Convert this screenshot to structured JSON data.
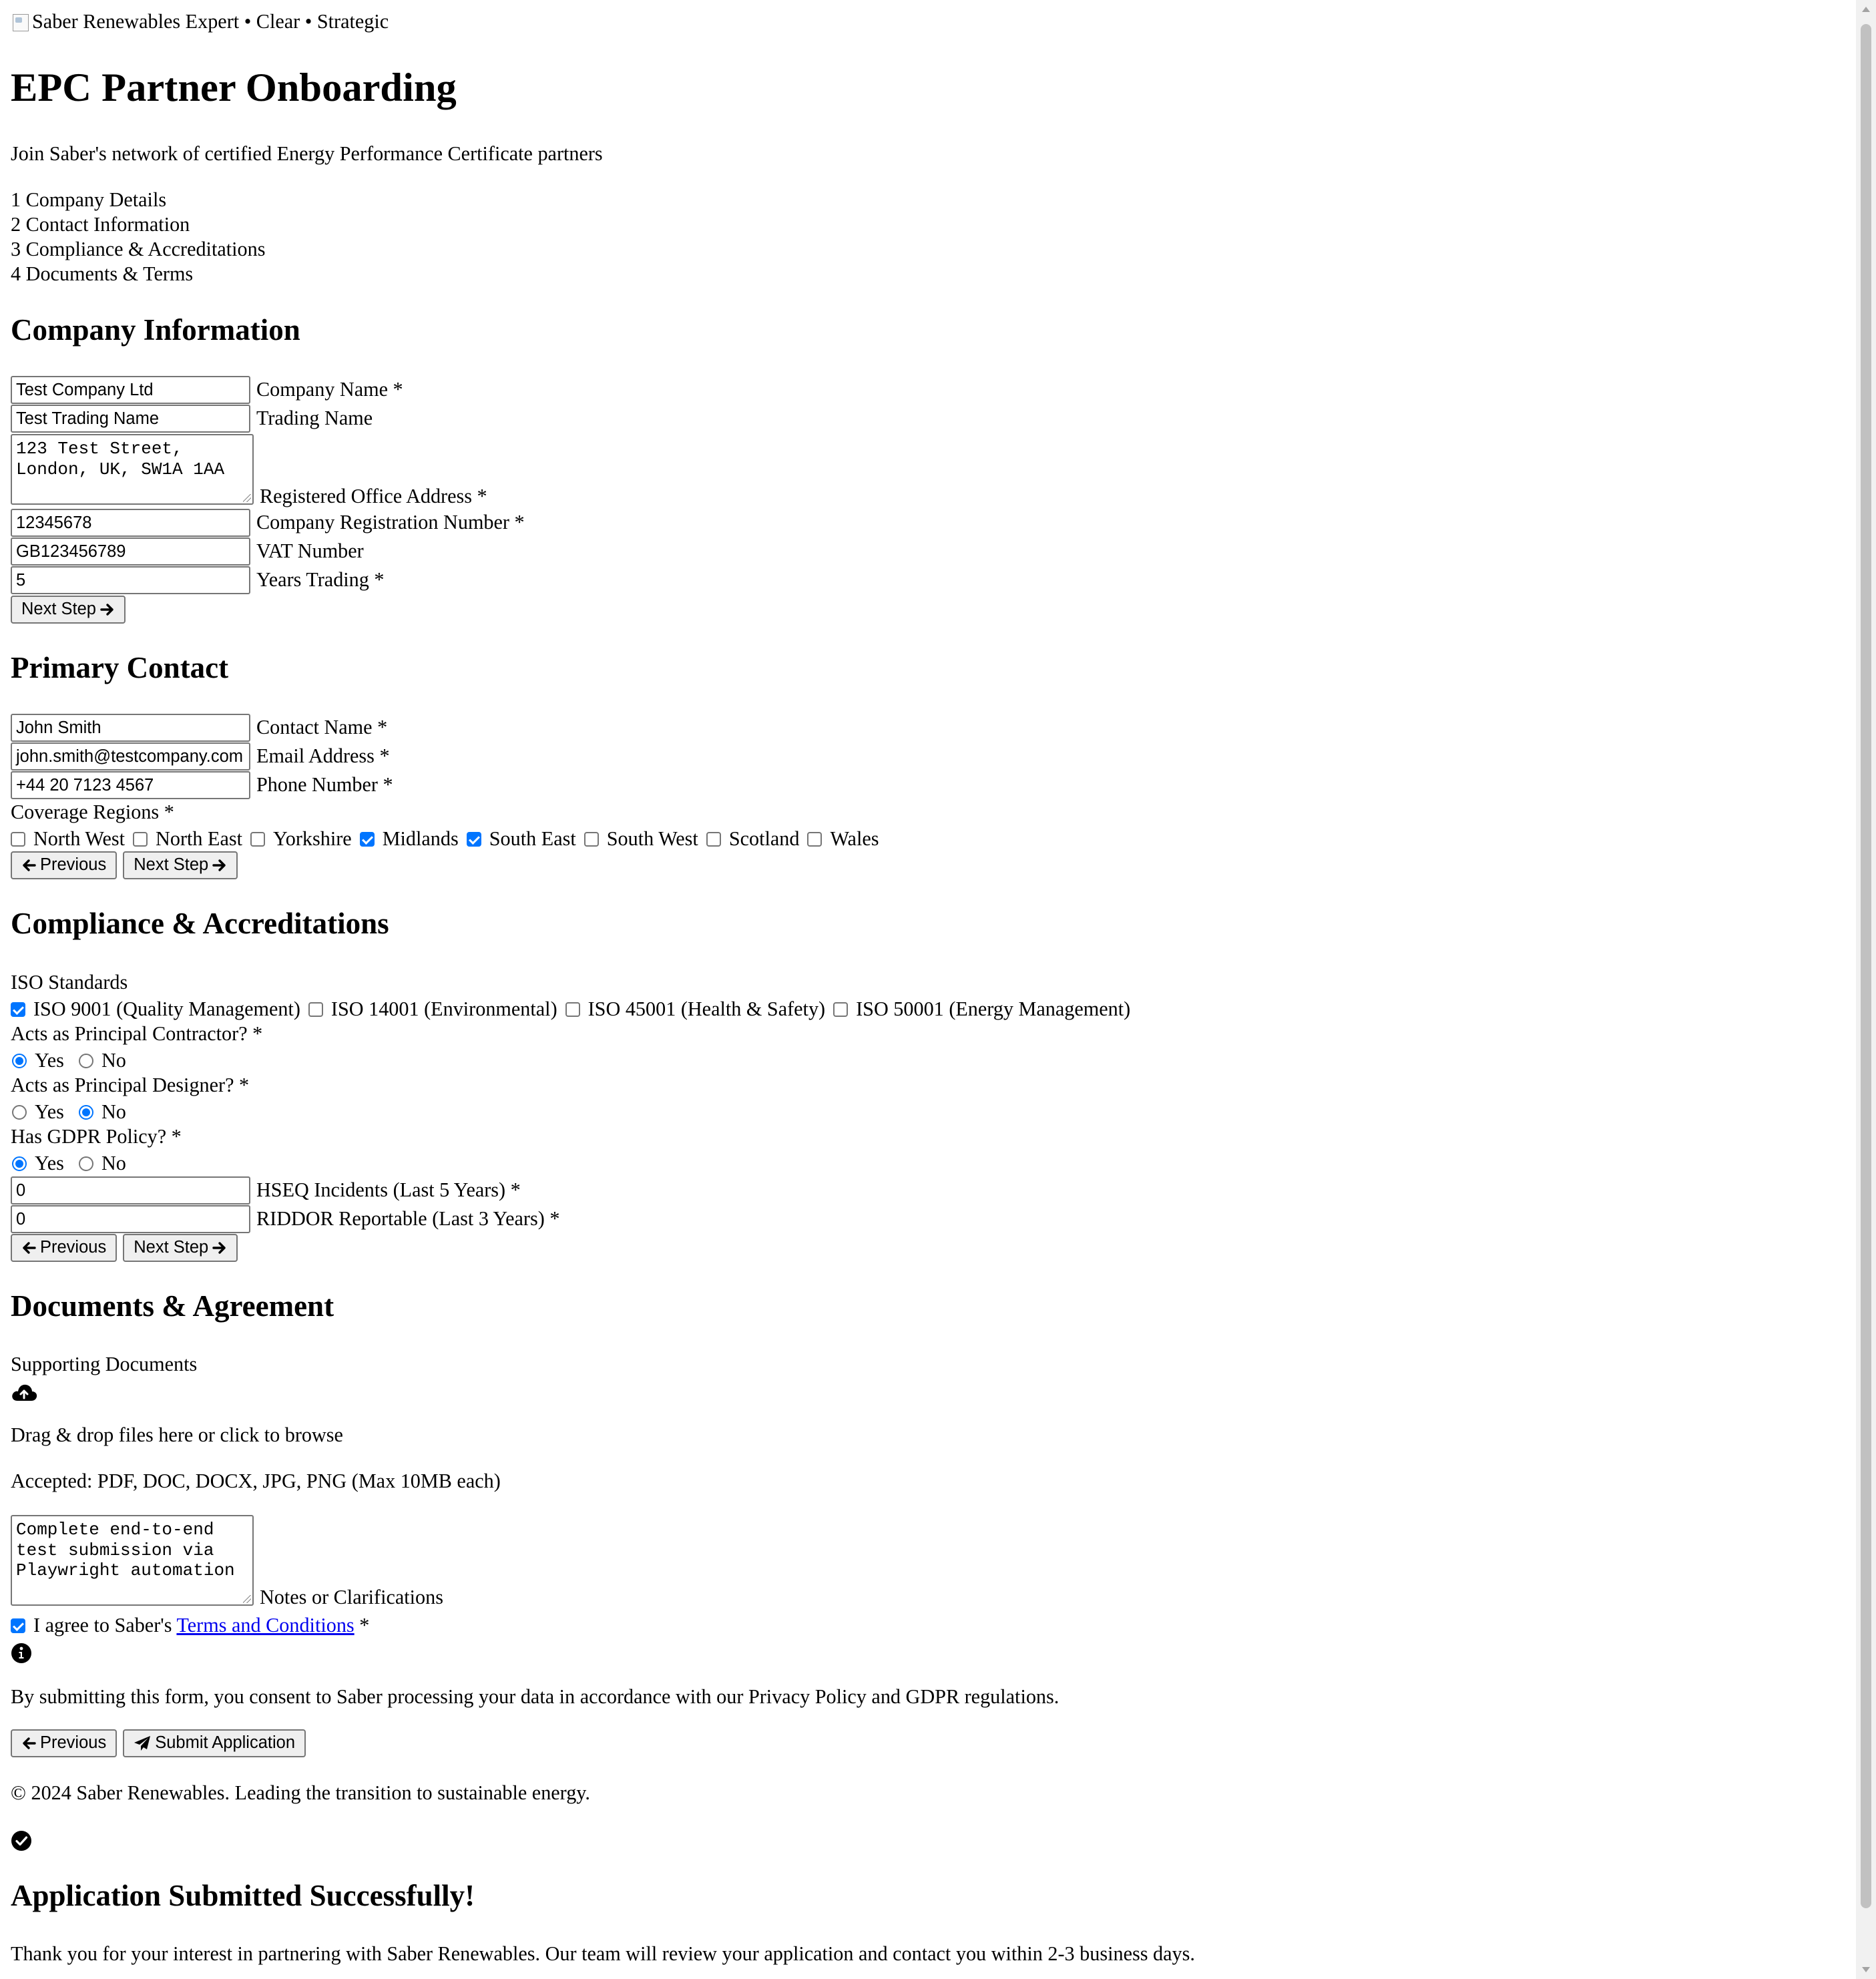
{
  "header": {
    "logo_alt": "Saber Renewables Expert • Clear • Strategic"
  },
  "page": {
    "title": "EPC Partner Onboarding",
    "subtitle": "Join Saber's network of certified Energy Performance Certificate partners"
  },
  "steps": [
    {
      "num": "1",
      "label": "Company Details"
    },
    {
      "num": "2",
      "label": "Contact Information"
    },
    {
      "num": "3",
      "label": "Compliance & Accreditations"
    },
    {
      "num": "4",
      "label": "Documents & Terms"
    }
  ],
  "company": {
    "heading": "Company Information",
    "company_name": {
      "value": "Test Company Ltd",
      "label": "Company Name *"
    },
    "trading_name": {
      "value": "Test Trading Name",
      "label": "Trading Name"
    },
    "address": {
      "value": "123 Test Street,\nLondon, UK, SW1A 1AA",
      "label": "Registered Office Address *"
    },
    "reg_number": {
      "value": "12345678",
      "label": "Company Registration Number *"
    },
    "vat": {
      "value": "GB123456789",
      "label": "VAT Number"
    },
    "years": {
      "value": "5",
      "label": "Years Trading *"
    },
    "next_label": "Next Step"
  },
  "contact": {
    "heading": "Primary Contact",
    "name": {
      "value": "John Smith",
      "label": "Contact Name *"
    },
    "email": {
      "value": "john.smith@testcompany.com",
      "label": "Email Address *"
    },
    "phone": {
      "value": "+44 20 7123 4567",
      "label": "Phone Number *"
    },
    "regions_label": "Coverage Regions *",
    "regions": [
      {
        "label": "North West",
        "checked": false
      },
      {
        "label": "North East",
        "checked": false
      },
      {
        "label": "Yorkshire",
        "checked": false
      },
      {
        "label": "Midlands",
        "checked": true
      },
      {
        "label": "South East",
        "checked": true
      },
      {
        "label": "South West",
        "checked": false
      },
      {
        "label": "Scotland",
        "checked": false
      },
      {
        "label": "Wales",
        "checked": false
      }
    ],
    "prev_label": "Previous",
    "next_label": "Next Step"
  },
  "compliance": {
    "heading": "Compliance & Accreditations",
    "iso_label": "ISO Standards",
    "iso": [
      {
        "label": "ISO 9001 (Quality Management)",
        "checked": true
      },
      {
        "label": "ISO 14001 (Environmental)",
        "checked": false
      },
      {
        "label": "ISO 45001 (Health & Safety)",
        "checked": false
      },
      {
        "label": "ISO 50001 (Energy Management)",
        "checked": false
      }
    ],
    "principal_contractor": {
      "label": "Acts as Principal Contractor? *",
      "yes": "Yes",
      "no": "No",
      "selected": "yes"
    },
    "principal_designer": {
      "label": "Acts as Principal Designer? *",
      "yes": "Yes",
      "no": "No",
      "selected": "no"
    },
    "gdpr": {
      "label": "Has GDPR Policy? *",
      "yes": "Yes",
      "no": "No",
      "selected": "yes"
    },
    "hseq": {
      "value": "0",
      "label": "HSEQ Incidents (Last 5 Years) *"
    },
    "riddor": {
      "value": "0",
      "label": "RIDDOR Reportable (Last 3 Years) *"
    },
    "prev_label": "Previous",
    "next_label": "Next Step"
  },
  "documents": {
    "heading": "Documents & Agreement",
    "supporting_label": "Supporting Documents",
    "upload_icon": "cloud-upload-icon",
    "drop_text": "Drag & drop files here or click to browse",
    "accepted_text": "Accepted: PDF, DOC, DOCX, JPG, PNG (Max 10MB each)",
    "notes": {
      "value": "Complete end-to-end\ntest submission via\nPlaywright automation",
      "label": "Notes or Clarifications"
    },
    "agree_prefix": "I agree to Saber's",
    "terms_link": "Terms and Conditions",
    "agree_suffix": "*",
    "agree_checked": true,
    "consent_text": "By submitting this form, you consent to Saber processing your data in accordance with our Privacy Policy and GDPR regulations.",
    "prev_label": "Previous",
    "submit_label": "Submit Application"
  },
  "footer": {
    "text": "© 2024 Saber Renewables. Leading the transition to sustainable energy."
  },
  "success": {
    "heading": "Application Submitted Successfully!",
    "message": "Thank you for your interest in partnering with Saber Renewables. Our team will review your application and contact you within 2-3 business days."
  },
  "colors": {
    "accent": "#0075ff",
    "link": "#0000ee"
  }
}
